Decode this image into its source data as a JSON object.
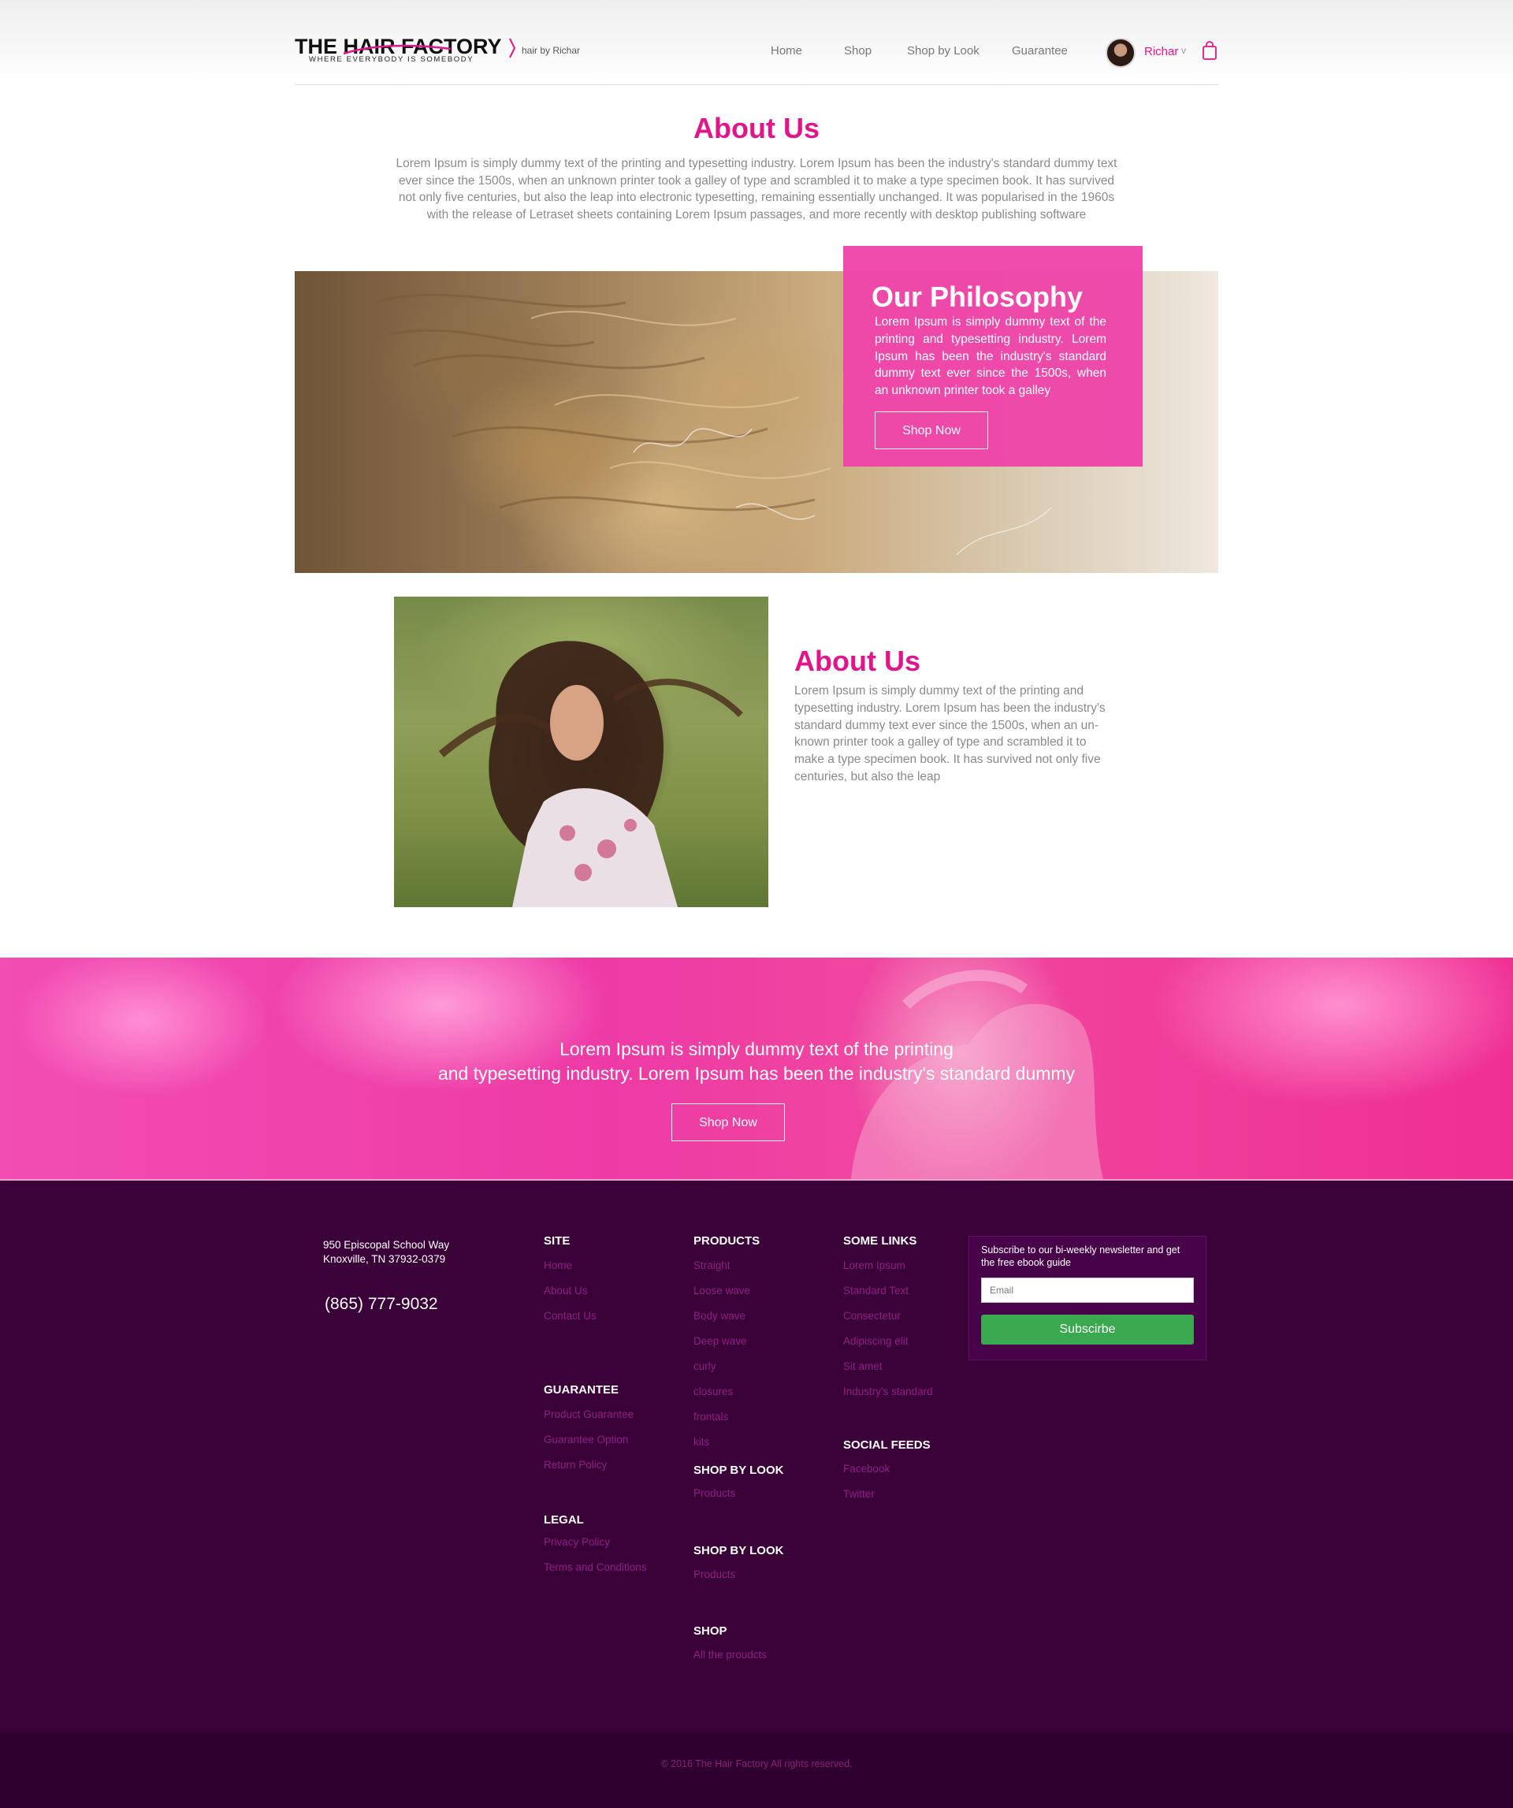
{
  "brand": {
    "logo_text": "THE HAIR FACTORY",
    "tagline": "WHERE EVERYBODY IS SOMEBODY",
    "sub": "hair by Richar",
    "accent_color": "#e0158a"
  },
  "nav": {
    "items": [
      "Home",
      "Shop",
      "Shop by Look",
      "Guarantee"
    ],
    "user_name": "Richar",
    "caret": "v"
  },
  "intro": {
    "title": "About Us",
    "text": "Lorem Ipsum is simply dummy text of the printing and typesetting industry. Lorem Ipsum has been the industry's standard dummy text ever since the 1500s, when an unknown printer took a galley of type and scrambled it to make a type specimen book. It has survived not only five centuries, but also the leap into electronic typesetting, remaining essentially unchanged. It was popularised in the 1960s with the release of Letraset sheets containing Lorem Ipsum passages, and more recently with desktop publishing software"
  },
  "philosophy": {
    "title": "Our Philosophy",
    "text": "Lorem Ipsum is simply dummy text of the printing and typesetting industry. Lorem Ipsum has been the industry's standard dummy text ever since the 1500s, when an unknown printer took a galley",
    "button": "Shop Now"
  },
  "about2": {
    "title": "About Us",
    "text": "Lorem Ipsum is simply dummy text of the printing and typesetting industry. Lorem Ipsum has been the industry's standard dummy text ever since the 1500s, when an un-known printer took a galley of type and scrambled it to make a type specimen book. It has survived not only five centuries, but also the leap"
  },
  "banner": {
    "line1": "Lorem Ipsum is simply dummy text of the printing",
    "line2": "and typesetting industry. Lorem Ipsum has been the industry's standard dummy",
    "button": "Shop Now"
  },
  "footer": {
    "address_line1": "950 Episcopal School Way",
    "address_line2": "Knoxville, TN 37932-0379",
    "phone": "(865) 777-9032",
    "site": {
      "heading": "SITE",
      "items": [
        "Home",
        "About Us",
        "Contact Us"
      ]
    },
    "guarantee": {
      "heading": "GUARANTEE",
      "items": [
        "Product Guarantee",
        "Guarantee Option",
        "Return Policy"
      ]
    },
    "legal": {
      "heading": "LEGAL",
      "items": [
        "Privacy Policy",
        "Terms and Conditions"
      ]
    },
    "products": {
      "heading": "PRODUCTS",
      "items": [
        "Straight",
        "Loose wave",
        "Body wave",
        "Deep wave",
        "curly",
        "closures",
        "frontals",
        "kits"
      ]
    },
    "shop_by_look_1": {
      "heading": "SHOP BY LOOK",
      "items": [
        "Products"
      ]
    },
    "shop_by_look_2": {
      "heading": "SHOP BY LOOK",
      "items": [
        "Products"
      ]
    },
    "shop": {
      "heading": "SHOP",
      "items": [
        "All the proudcts"
      ]
    },
    "some_links": {
      "heading": "SOME LINKS",
      "items": [
        "Lorem Ipsum",
        "Standard Text",
        "Consectetur",
        "Adipiscing elit",
        "Sit amet",
        "Industry's standard"
      ]
    },
    "social": {
      "heading": "SOCIAL FEEDS",
      "items": [
        "Facebook",
        "Twitter"
      ]
    },
    "newsletter": {
      "text": "Subscribe to our bi-weekly newsletter and get the free ebook guide",
      "placeholder": "Email",
      "button": "Subscirbe"
    },
    "copyright": "© 2016 The Hair Factory All rights reserved."
  }
}
